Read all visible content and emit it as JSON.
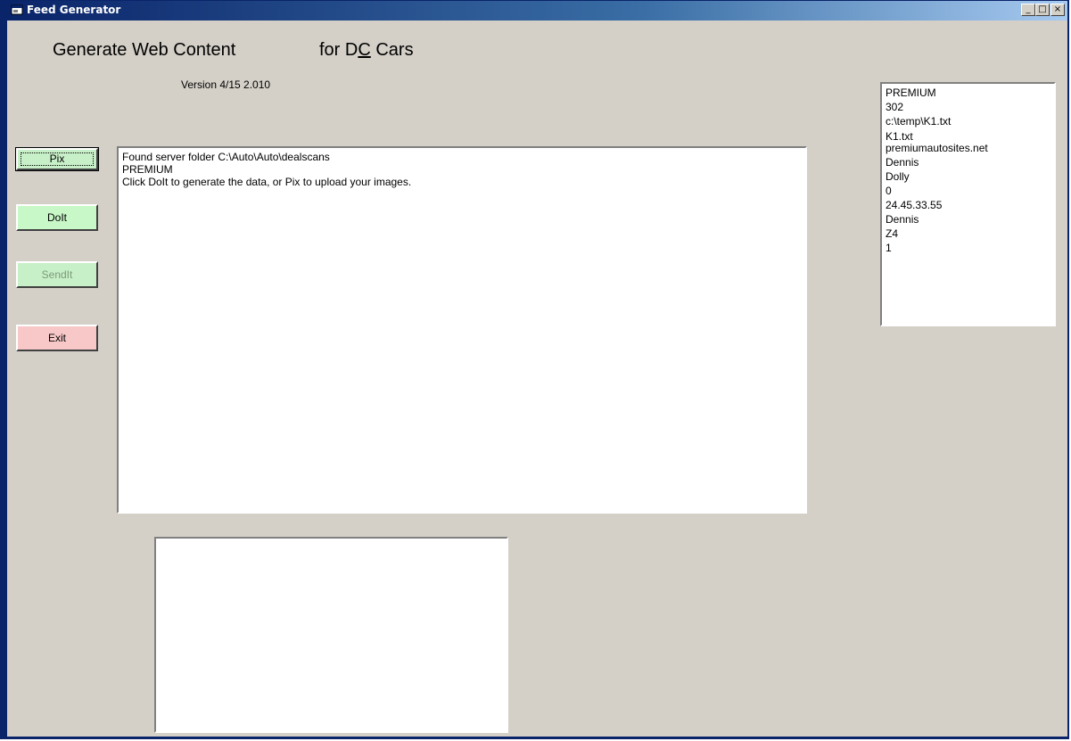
{
  "window": {
    "title": "Feed Generator",
    "controls": {
      "minimize": "_",
      "maximize": "□",
      "close": "×"
    }
  },
  "header": {
    "title_left": "Generate Web Content",
    "title_right_prefix": "for D",
    "title_right_underlined": "C",
    "title_right_suffix": " Cars",
    "version": "Version 4/15 2.010"
  },
  "buttons": {
    "pix": "Pix",
    "doit": "DoIt",
    "sendit": "SendIt",
    "exit": "Exit"
  },
  "colors": {
    "pix_bg": "#c8f0c8",
    "doit_bg": "#c8f8c8",
    "sendit_bg": "#c8f0c8",
    "sendit_text": "#7a9a7a",
    "exit_bg": "#f8c8c8"
  },
  "log": {
    "lines": [
      "Found server folder C:\\Auto\\Auto\\dealscans",
      "PREMIUM",
      "Click DoIt to generate the data, or Pix to upload your images."
    ]
  },
  "info": {
    "lines": [
      "PREMIUM",
      "302",
      "c:\\temp\\K1.txt",
      "K1.txt",
      "premiumautosites.net",
      "Dennis",
      "Dolly",
      "0",
      "24.45.33.55",
      "Dennis",
      "Z4",
      "1"
    ]
  }
}
